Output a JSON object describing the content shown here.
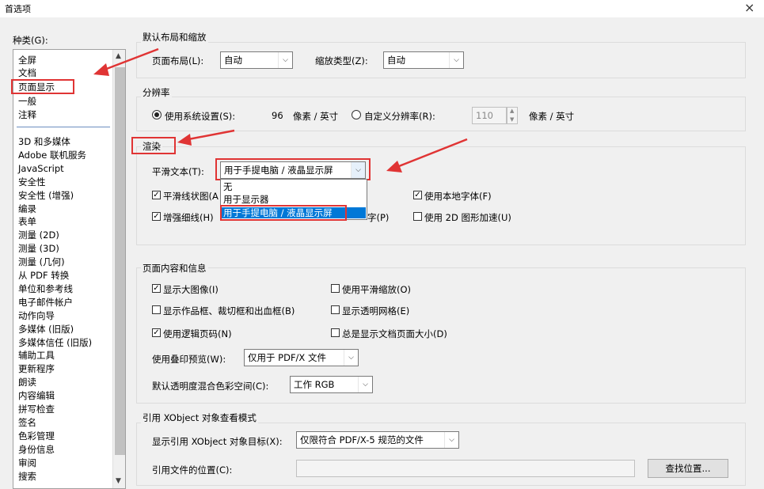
{
  "window": {
    "title": "首选项",
    "close_glyph": "×"
  },
  "category": {
    "label": "种类(G):",
    "items_top": [
      "全屏",
      "文档",
      "页面显示",
      "一般",
      "注释"
    ],
    "items": [
      "3D 和多媒体",
      "Adobe 联机服务",
      "JavaScript",
      "安全性",
      "安全性 (增强)",
      "编录",
      "表单",
      "测量 (2D)",
      "测量 (3D)",
      "测量 (几何)",
      "从 PDF 转换",
      "单位和参考线",
      "电子邮件帐户",
      "动作向导",
      "多媒体 (旧版)",
      "多媒体信任 (旧版)",
      "辅助工具",
      "更新程序",
      "朗读",
      "内容编辑",
      "拼写检查",
      "签名",
      "色彩管理",
      "身份信息",
      "审阅",
      "搜索"
    ],
    "selected": "页面显示"
  },
  "layout_zoom": {
    "title": "默认布局和缩放",
    "page_layout_label": "页面布局(L):",
    "page_layout_value": "自动",
    "zoom_label": "缩放类型(Z):",
    "zoom_value": "自动"
  },
  "resolution": {
    "title": "分辨率",
    "system_label": "使用系统设置(S):",
    "system_value": "96",
    "unit": "像素 / 英寸",
    "custom_label": "自定义分辨率(R):",
    "custom_value": "110",
    "custom_unit": "像素 / 英寸"
  },
  "render": {
    "title": "渲染",
    "smooth_text_label": "平滑文本(T):",
    "smooth_text_value": "用于手提电脑 / 液晶显示屏",
    "options": [
      "无",
      "用于显示器",
      "用于手提电脑 / 液晶显示屏"
    ],
    "smooth_line_label": "平滑线状图(A",
    "enhance_thin_label": "增强细线(H)",
    "partial_text": "字(P)",
    "local_fonts_label": "使用本地字体(F)",
    "gpu_label": "使用 2D 图形加速(U)"
  },
  "page_content": {
    "title": "页面内容和信息",
    "show_large_images": "显示大图像(I)",
    "smooth_zoom": "使用平滑缩放(O)",
    "show_art_trim": "显示作品框、裁切框和出血框(B)",
    "show_transparency_grid": "显示透明网格(E)",
    "use_logical_page_numbers": "使用逻辑页码(N)",
    "always_show_page_size": "总是显示文档页面大小(D)",
    "overprint_label": "使用叠印预览(W):",
    "overprint_value": "仅用于 PDF/X 文件",
    "blend_label": "默认透明度混合色彩空间(C):",
    "blend_value": "工作 RGB"
  },
  "xobject": {
    "title": "引用 XObject 对象查看模式",
    "show_target_label": "显示引用 XObject 对象目标(X):",
    "show_target_value": "仅限符合 PDF/X-5 规范的文件",
    "location_label": "引用文件的位置(C):",
    "location_value": "",
    "find_button": "查找位置..."
  },
  "glyphs": {
    "check": "✓",
    "arrow_down": "⌵",
    "spin_up": "▲",
    "spin_down": "▼",
    "scroll_up": "▲",
    "scroll_down": "▼"
  },
  "colors": {
    "accent": "#0078d7",
    "annotation_red": "#e03434"
  }
}
